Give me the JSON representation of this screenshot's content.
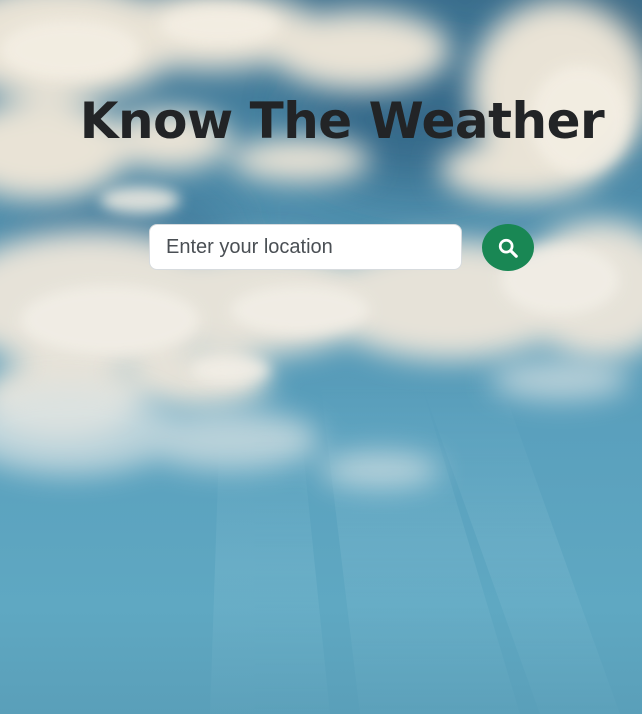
{
  "page": {
    "title": "Know The Weather"
  },
  "search": {
    "value": "",
    "placeholder": "Enter your location",
    "button_icon": "search-icon"
  },
  "colors": {
    "title": "#222426",
    "button": "#198754",
    "sky": "#5aa0bd"
  }
}
